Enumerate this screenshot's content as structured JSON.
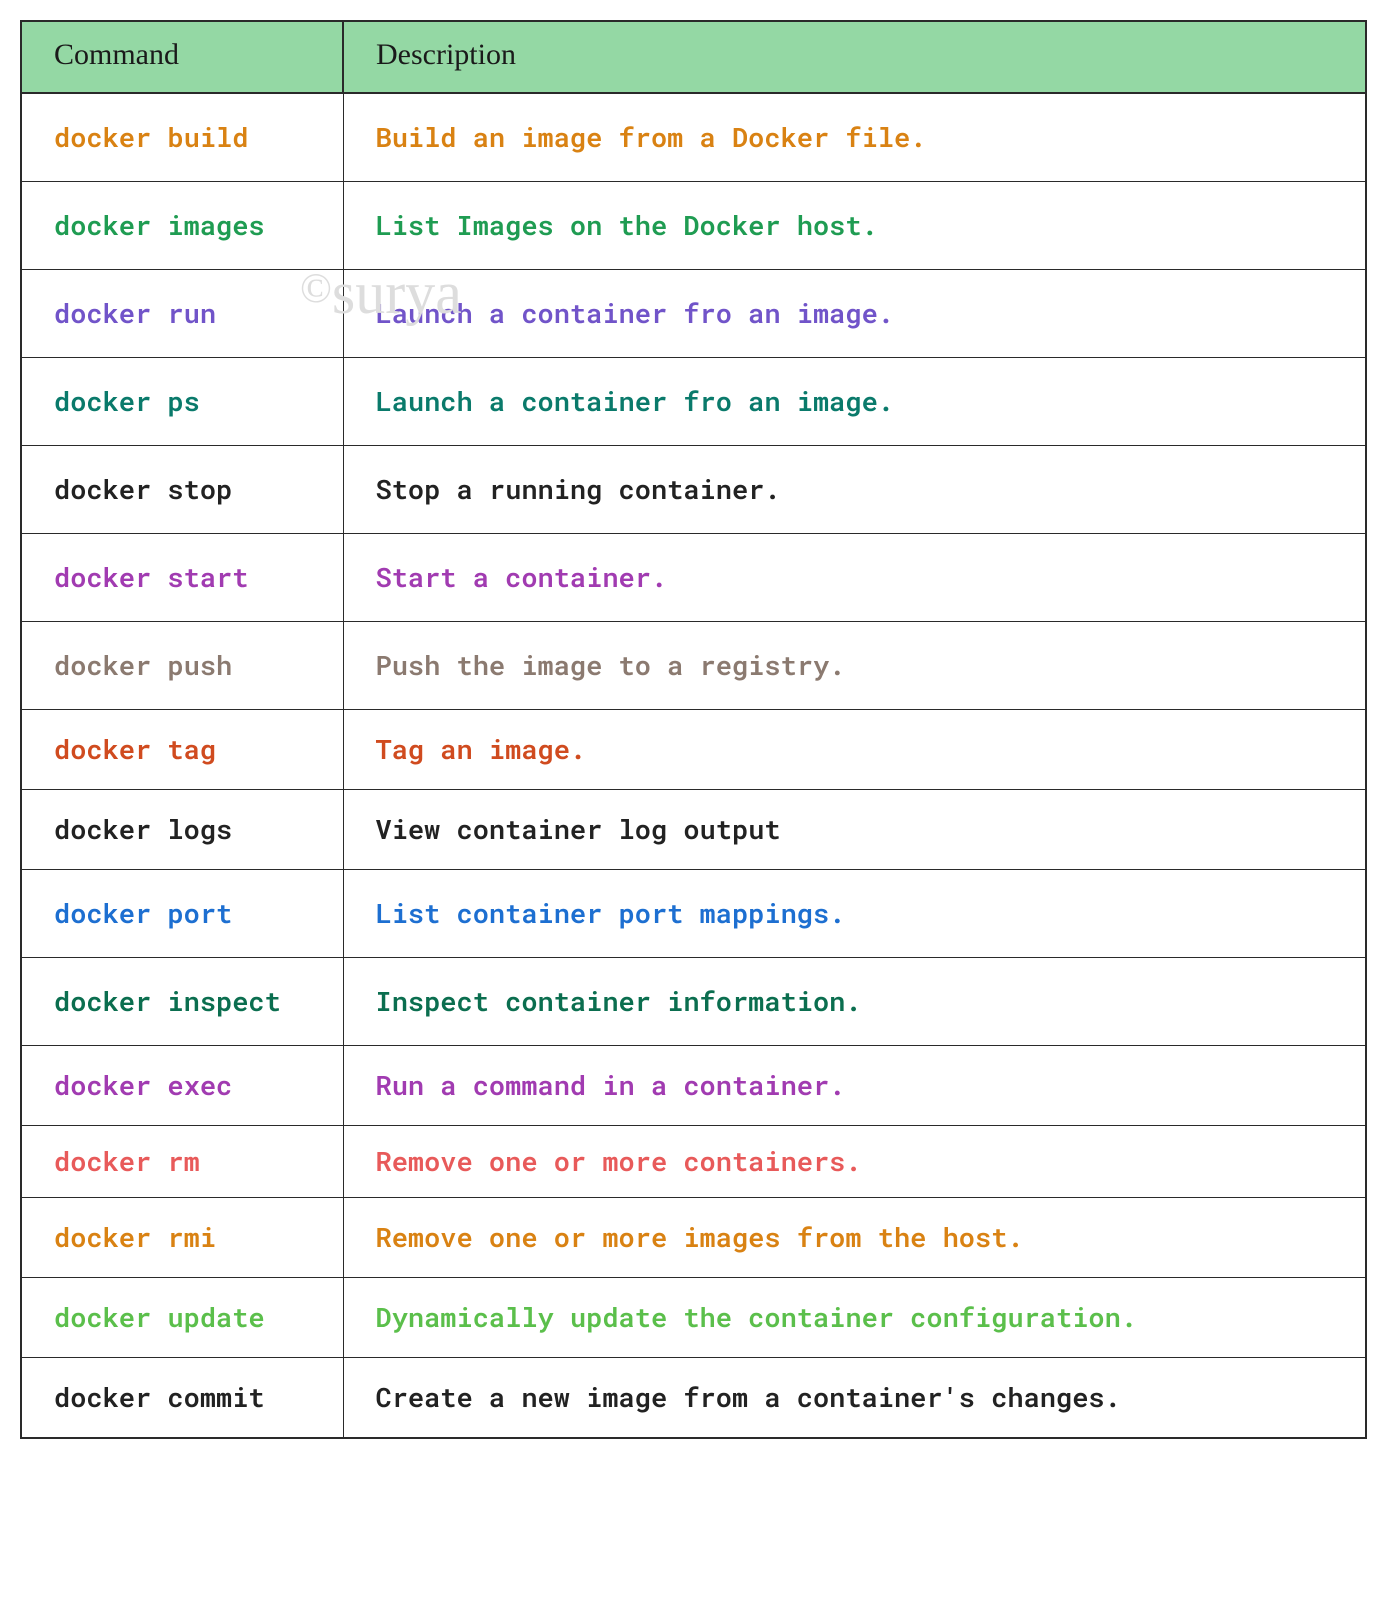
{
  "header": {
    "col1": "Command",
    "col2": "Description"
  },
  "rows": [
    {
      "cmd": "docker build",
      "desc": "Build an image from a Docker file.",
      "color": "c-orange",
      "size": ""
    },
    {
      "cmd": "docker images",
      "desc": "List Images on the Docker host.",
      "color": "c-green",
      "size": ""
    },
    {
      "cmd": "docker run",
      "desc": "Launch a container fro an image.",
      "color": "c-purple",
      "size": ""
    },
    {
      "cmd": "docker ps",
      "desc": "Launch a container fro an image.",
      "color": "c-teal",
      "size": ""
    },
    {
      "cmd": "docker stop",
      "desc": "Stop a running container.",
      "color": "c-black",
      "size": ""
    },
    {
      "cmd": "docker start",
      "desc": "Start a container.",
      "color": "c-magenta",
      "size": ""
    },
    {
      "cmd": "docker push",
      "desc": "Push the image to a registry.",
      "color": "c-brown",
      "size": ""
    },
    {
      "cmd": "docker tag",
      "desc": "Tag an image.",
      "color": "c-dorange",
      "size": "tight"
    },
    {
      "cmd": "docker logs",
      "desc": "View container log output",
      "color": "c-black",
      "size": "tight"
    },
    {
      "cmd": "docker port",
      "desc": "List container port mappings.",
      "color": "c-blue",
      "size": ""
    },
    {
      "cmd": "docker inspect",
      "desc": "Inspect container information.",
      "color": "c-dgreen",
      "size": ""
    },
    {
      "cmd": "docker exec",
      "desc": "Run a command in a container.",
      "color": "c-magenta",
      "size": "tight"
    },
    {
      "cmd": "docker rm",
      "desc": "Remove one or more containers.",
      "color": "c-red",
      "size": "tighter"
    },
    {
      "cmd": "docker rmi",
      "desc": "Remove one or more images from the host.",
      "color": "c-orange",
      "size": "tight"
    },
    {
      "cmd": "docker update",
      "desc": "Dynamically update the container configuration.",
      "color": "c-lime",
      "size": "tight"
    },
    {
      "cmd": "docker commit",
      "desc": "Create a new image from a container's changes.",
      "color": "c-black",
      "size": "tight"
    }
  ],
  "watermark": {
    "copy": "©",
    "name": "surya"
  }
}
